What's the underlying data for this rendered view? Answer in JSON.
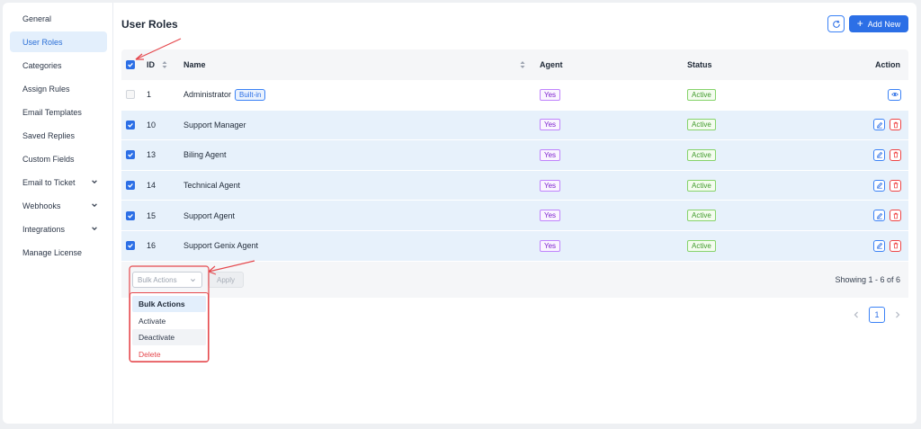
{
  "sidebar": {
    "items": [
      {
        "label": "General"
      },
      {
        "label": "User Roles"
      },
      {
        "label": "Categories"
      },
      {
        "label": "Assign Rules"
      },
      {
        "label": "Email Templates"
      },
      {
        "label": "Saved Replies"
      },
      {
        "label": "Custom Fields"
      },
      {
        "label": "Email to Ticket"
      },
      {
        "label": "Webhooks"
      },
      {
        "label": "Integrations"
      },
      {
        "label": "Manage License"
      }
    ]
  },
  "header": {
    "title": "User Roles",
    "add_label": "Add New"
  },
  "table": {
    "columns": {
      "id": "ID",
      "name": "Name",
      "agent": "Agent",
      "status": "Status",
      "action": "Action"
    },
    "rows": [
      {
        "id": "1",
        "name": "Administrator",
        "badge": "Built-in",
        "agent": "Yes",
        "status": "Active"
      },
      {
        "id": "10",
        "name": "Support Manager",
        "agent": "Yes",
        "status": "Active"
      },
      {
        "id": "13",
        "name": "Biling Agent",
        "agent": "Yes",
        "status": "Active"
      },
      {
        "id": "14",
        "name": "Technical Agent",
        "agent": "Yes",
        "status": "Active"
      },
      {
        "id": "15",
        "name": "Support Agent",
        "agent": "Yes",
        "status": "Active"
      },
      {
        "id": "16",
        "name": "Support Genix Agent",
        "agent": "Yes",
        "status": "Active"
      }
    ]
  },
  "footer": {
    "bulk_placeholder": "Bulk Actions",
    "apply_label": "Apply",
    "showing": "Showing 1 - 6 of 6"
  },
  "bulk_menu": {
    "options": [
      "Bulk Actions",
      "Activate",
      "Deactivate",
      "Delete"
    ]
  },
  "pagination": {
    "current_page": "1"
  },
  "colors": {
    "accent": "#2c6fe6",
    "selected_row": "#e7f1fb",
    "annotation": "#e5484d"
  }
}
